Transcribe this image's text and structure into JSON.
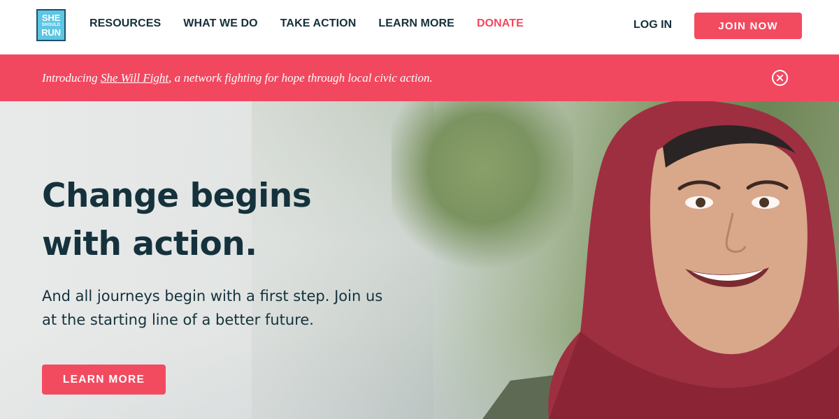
{
  "logo": {
    "line1": "SHE",
    "line2": "SHOULD",
    "line3": "RUN"
  },
  "nav": {
    "items": [
      {
        "label": "RESOURCES"
      },
      {
        "label": "WHAT WE DO"
      },
      {
        "label": "TAKE ACTION"
      },
      {
        "label": "LEARN MORE"
      },
      {
        "label": "DONATE"
      }
    ],
    "login": "LOG IN",
    "join": "JOIN NOW"
  },
  "banner": {
    "prefix": "Introducing ",
    "link": "She Will Fight",
    "suffix": ", a network fighting for hope through local civic action."
  },
  "hero": {
    "title": "Change begins with action.",
    "subtitle": "And all journeys begin with a first step. Join us at the starting line of a better future.",
    "button": "LEARN MORE"
  },
  "colors": {
    "accent": "#f24b60",
    "navy": "#15323c",
    "logo_blue": "#5cc6e3"
  },
  "icons": [
    "close-circle-icon"
  ]
}
